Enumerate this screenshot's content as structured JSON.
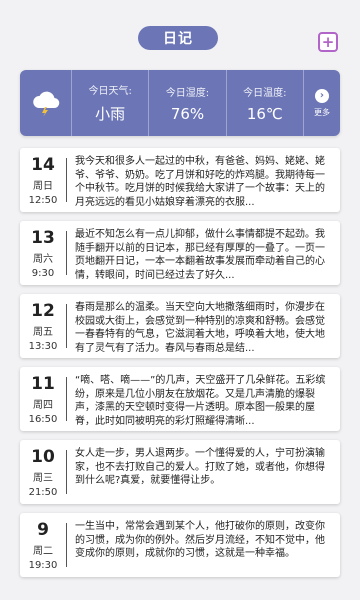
{
  "header": {
    "title": "日记",
    "add_icon": "plus-square-icon"
  },
  "weather": {
    "icon": "cloud-lightning-icon",
    "items": [
      {
        "label": "今日天气:",
        "value": "小雨"
      },
      {
        "label": "今日湿度:",
        "value": "76%"
      },
      {
        "label": "今日温度:",
        "value": "16℃"
      }
    ],
    "more_label": "更多",
    "accent": "#6c76b6"
  },
  "entries": [
    {
      "day": "14",
      "weekday": "周日",
      "time": "12:50",
      "text": "我今天和很多人一起过的中秋，有爸爸、妈妈、姥姥、姥爷、爷爷、奶奶。吃了月饼和好吃的炸鸡腿。我期待每一个中秋节。吃月饼的时候我给大家讲了一个故事：天上的月亮远远的看见小姑娘穿着漂亮的衣服..."
    },
    {
      "day": "13",
      "weekday": "周六",
      "time": "9:30",
      "text": "最近不知怎么有一点儿抑郁，做什么事情都提不起劲。我随手翻开以前的日记本，那已经有厚厚的一叠了。一页一页地翻开日记，一本一本翻着故事发展而牵动着自己的心情，转眼间，时间已经过去了好久..."
    },
    {
      "day": "12",
      "weekday": "周五",
      "time": "13:30",
      "text": "春雨是那么的温柔。当天空向大地撒落细雨时，你漫步在校园或大街上，会感觉到一种特别的凉爽和舒畅。会感觉一春春特有的气息，它滋润着大地，呼唤着大地，使大地有了灵气有了活力。春风与春雨总是结..."
    },
    {
      "day": "11",
      "weekday": "周四",
      "time": "16:50",
      "text": "“嘀、嗒、嘀——”的几声，天空盛开了几朵鲜花。五彩缤纷，原来是几位小朋友在放烟花。又是几声清脆的爆裂声，漆黑的天空顿时变得一片透明。原本图一般果的屋脊，此时如同被明亮的彩灯照耀得清晰..."
    },
    {
      "day": "10",
      "weekday": "周三",
      "time": "21:50",
      "text": "女人走一步，男人退两步。一个懂得爱的人，宁可扮演输家，也不去打败自己的爱人。打败了她，或者他，你想得到什么呢?真爱，就要懂得让步。"
    },
    {
      "day": "9",
      "weekday": "周二",
      "time": "19:30",
      "text": "一生当中，常常会遇到某个人，他打破你的原则，改变你的习惯，成为你的例外。然后岁月流经，不知不觉中，他变成你的原则，成就你的习惯，这就是一种幸福。"
    }
  ]
}
